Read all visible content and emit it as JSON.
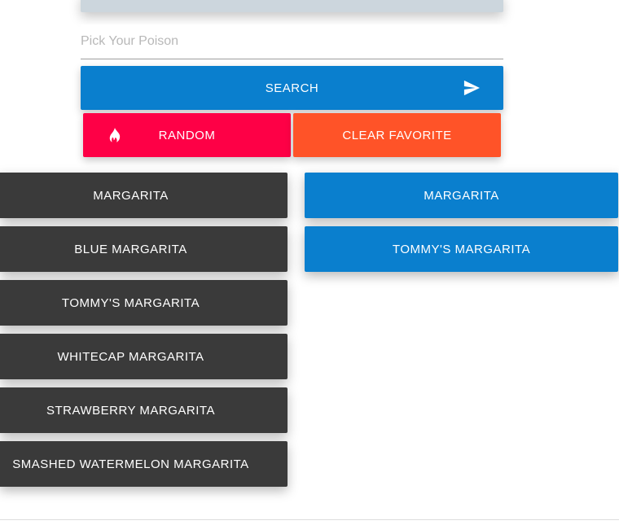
{
  "search": {
    "placeholder": "Pick Your Poison",
    "value": "",
    "button_label": "SEARCH"
  },
  "actions": {
    "random_label": "RANDOM",
    "clear_favorite_label": "CLEAR FAVORITE"
  },
  "results": [
    {
      "label": "MARGARITA"
    },
    {
      "label": "BLUE MARGARITA"
    },
    {
      "label": "TOMMY'S MARGARITA"
    },
    {
      "label": "WHITECAP MARGARITA"
    },
    {
      "label": "STRAWBERRY MARGARITA"
    },
    {
      "label": "SMASHED WATERMELON MARGARITA"
    }
  ],
  "favorites": [
    {
      "label": "MARGARITA"
    },
    {
      "label": "TOMMY'S MARGARITA"
    }
  ],
  "icons": {
    "search_button_icon": "send-icon",
    "random_button_icon": "fire-icon"
  },
  "colors": {
    "header_bar": "#ccd6dd",
    "search_button": "#0a7fce",
    "random_button": "#fe0046",
    "clear_button": "#ff5328",
    "result_item": "#3a3a3a",
    "favorite_item": "#0a7fce"
  }
}
